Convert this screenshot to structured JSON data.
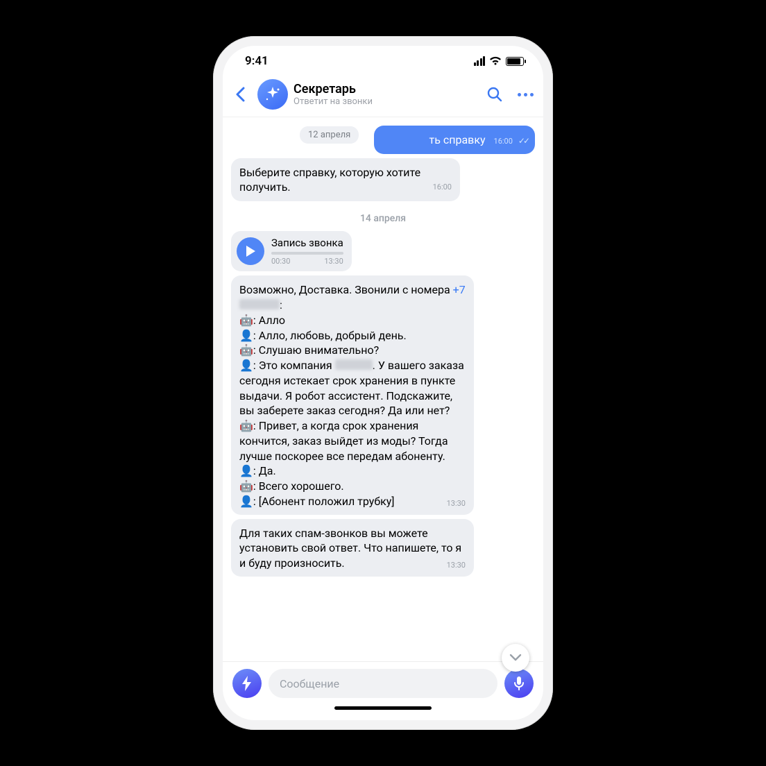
{
  "status": {
    "time": "9:41"
  },
  "header": {
    "title": "Секретарь",
    "subtitle": "Ответит на звонки"
  },
  "dates": {
    "floating": "12 апреля",
    "section": "14 апреля"
  },
  "messages": {
    "out1_text": "ть справку",
    "out1_time": "16:00",
    "in1_text": "Выберите справку, которую хотите получить.",
    "in1_time": "16:00",
    "voice_title": "Запись звонка",
    "voice_elapsed": "00:30",
    "voice_time": "13:30",
    "transcript_intro_a": "Возможно, Доставка. Звонили с номера ",
    "transcript_phone_prefix": "+7",
    "transcript_lines": [
      "🤖: Алло",
      "👤: Алло, любовь, добрый день.",
      "🤖: Слушаю внимательно?",
      "👤: Это компания ",
      ". У вашего заказа сегодня истекает срок хранения в пункте выдачи. Я робот ассистент. Подскажите, вы заберете заказ сегодня? Да или нет?",
      "🤖: Привет, а когда срок хранения кончится, заказ выйдет из моды? Тогда лучше поскорее все передам абоненту.",
      "👤: Да.",
      "🤖: Всего хорошего.",
      "👤: [Абонент положил трубку]"
    ],
    "transcript_time": "13:30",
    "spam_text": "Для таких спам-звонков вы можете установить свой ответ. Что напишете, то я и буду произносить.",
    "spam_time": "13:30"
  },
  "input": {
    "placeholder": "Сообщение"
  }
}
